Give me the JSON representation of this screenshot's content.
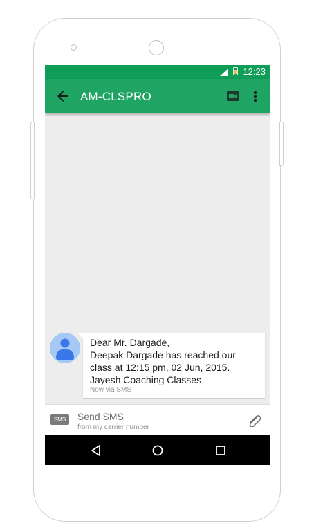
{
  "status_bar": {
    "time": "12:23"
  },
  "toolbar": {
    "title": "AM-CLSPRO",
    "back_icon": "arrow-back-icon",
    "video_icon": "videocam-icon",
    "menu_icon": "more-vert-icon"
  },
  "message": {
    "lines": [
      "Dear Mr. Dargade,",
      "Deepak Dargade has reached our",
      "class at 12:15 pm, 02 Jun, 2015.",
      "Jayesh Coaching Classes"
    ],
    "meta": "Now via SMS",
    "avatar_color": "#a6c8f6"
  },
  "compose": {
    "badge": "SMS",
    "placeholder": "Send SMS",
    "subtext": "from my carrier number"
  },
  "colors": {
    "status_bar": "#0f9d58",
    "toolbar": "#1fa463",
    "avatar_figure": "#3a77e8"
  }
}
